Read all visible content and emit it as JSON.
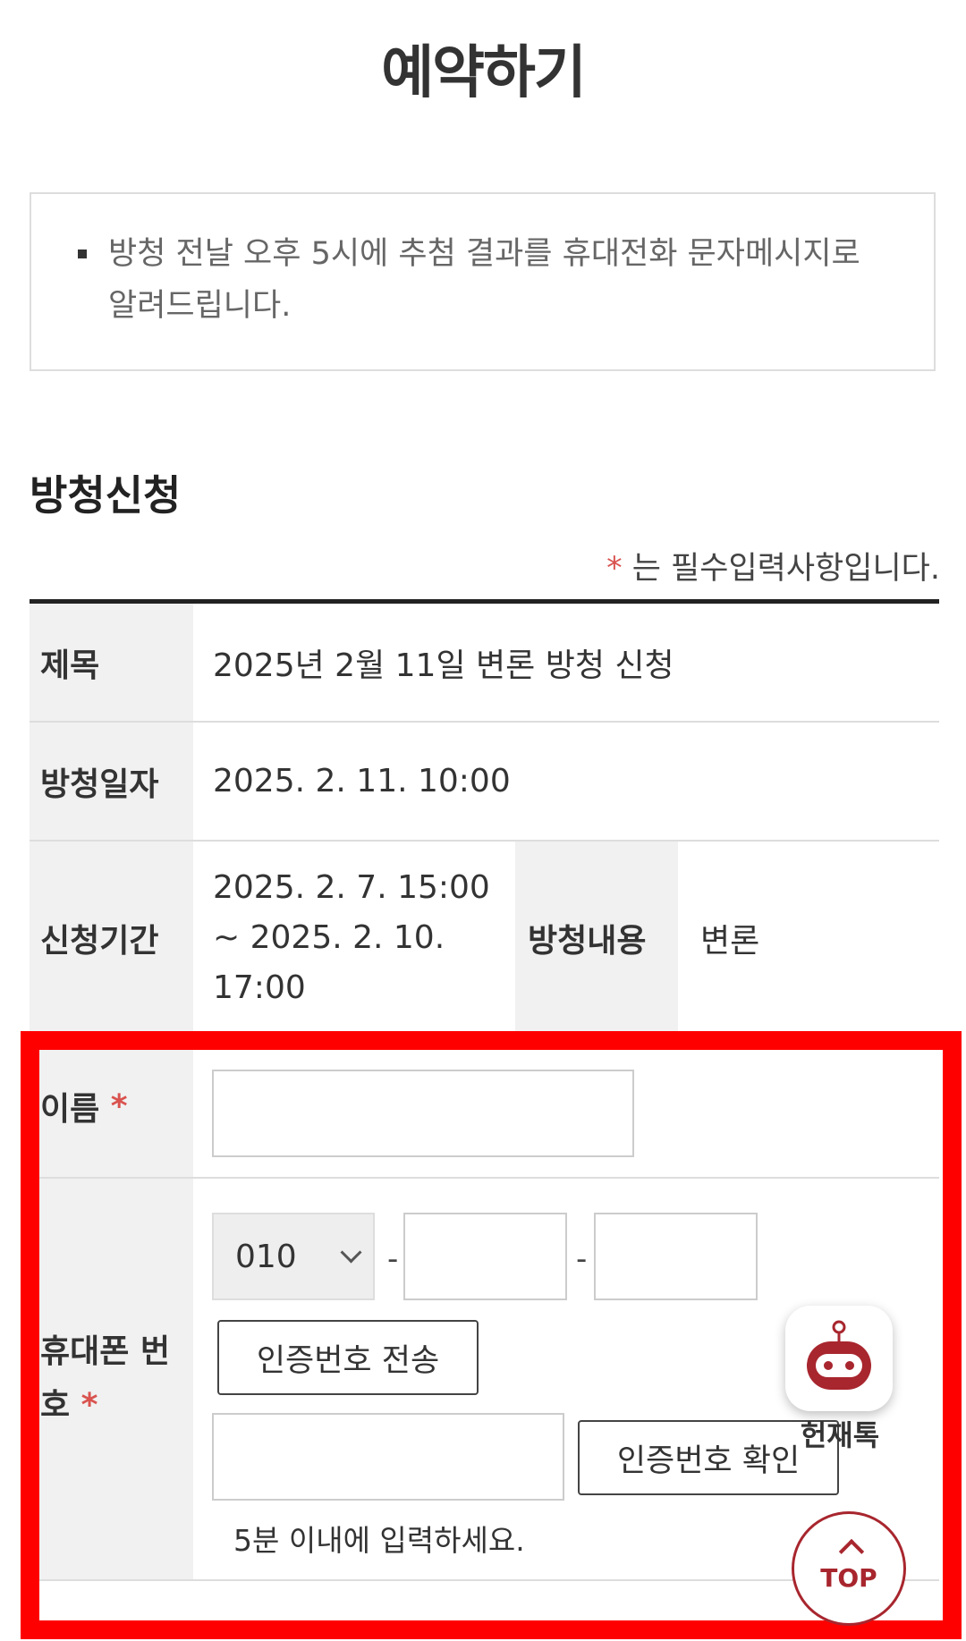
{
  "page": {
    "title": "예약하기"
  },
  "notice": {
    "text": "방청 전날 오후 5시에 추첨 결과를 휴대전화 문자메시지로 알려드립니다."
  },
  "section": {
    "title": "방청신청",
    "required_star": "*",
    "required_note": " 는 필수입력사항입니다."
  },
  "form": {
    "title_label": "제목",
    "title_value": "2025년 2월 11일 변론 방청 신청",
    "date_label": "방청일자",
    "date_value": "2025. 2. 11.  10:00",
    "period_label": "신청기간",
    "period_value": "2025. 2. 7.  15:00 ~  2025. 2. 10.  17:00",
    "content_label": "방청내용",
    "content_value": "변론",
    "name_label": "이름",
    "name_value": "",
    "phone_label": "휴대폰 번호",
    "phone_prefix": "010",
    "phone_separator": "-",
    "phone_middle": "",
    "phone_last": "",
    "send_code_button": "인증번호 전송",
    "code_value": "",
    "verify_button": "인증번호 확인",
    "hint": "5분 이내에 입력하세요."
  },
  "floating": {
    "chatbot_label": "헌재톡",
    "top_label": "TOP"
  },
  "colors": {
    "highlight": "#ff0000",
    "required": "#d9534f",
    "top_button": "#a8262e",
    "header_cell": "#f1f1f1"
  }
}
